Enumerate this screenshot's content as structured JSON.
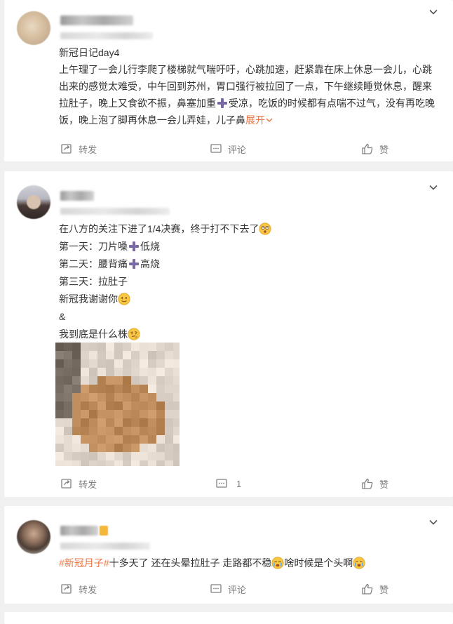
{
  "posts": [
    {
      "content_lines": [
        "新冠日记day4",
        "上午理了一会儿行李爬了楼梯就气喘吁吁，心跳加速，赶紧靠在床上休息一会儿，心跳出来的感觉太难受，中午回到苏州，胃口强行被拉回了一点，下午继续睡觉休息，醒来拉肚子，晚上又食欲不振，鼻塞加重",
        "受凉，吃饭的时候都有点喘不过气，没有再吃晚饭，晚上泡了脚再休息一会儿弄娃，儿子鼻"
      ],
      "expand_label": "展开",
      "actions": {
        "repost": "转发",
        "comment": "评论",
        "like": "赞"
      }
    },
    {
      "lines": [
        "在八方的关注下进了1/4决赛，终于打不下去了",
        "第一天：刀片嗓",
        "低烧",
        "第二天：腰背痛",
        "高烧",
        "第三天：拉肚子",
        "新冠我谢谢你",
        "&",
        "我到底是什么株"
      ],
      "actions": {
        "repost": "转发",
        "comment": "1",
        "like": "赞"
      }
    },
    {
      "topic": "#新冠月子#",
      "text_a": "十多天了 还在头晕拉肚子 走路都不稳",
      "text_b": "啥时候是个头啊",
      "actions": {
        "repost": "转发",
        "comment": "评论",
        "like": "赞"
      }
    }
  ],
  "icons": {
    "chevron": "chevron-down-icon",
    "repost": "repost-icon",
    "comment": "comment-icon",
    "like": "like-icon",
    "plus": "plus-emoji-icon",
    "shocked": "shocked-emoji-icon",
    "smile": "smile-emoji-icon",
    "thinking": "thinking-emoji-icon",
    "crying": "crying-emoji-icon"
  },
  "colors": {
    "accent": "#eb7340",
    "action_gray": "#808080",
    "text": "#333333",
    "background": "#f0f0f0"
  }
}
